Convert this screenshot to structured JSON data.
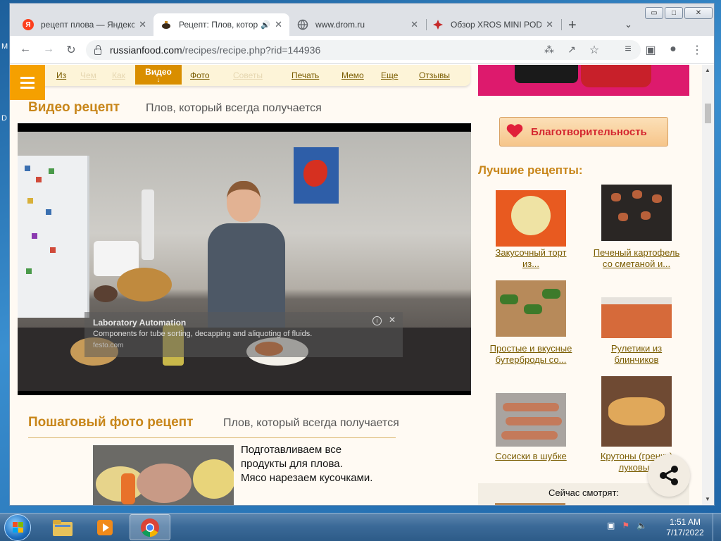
{
  "desktop": {
    "left_glyph_top": "M",
    "left_glyph_mid": "D"
  },
  "window": {
    "min_label": "▭",
    "max_label": "□",
    "close_label": "✕"
  },
  "tabs": [
    {
      "title": "рецепт плова — Яндекс",
      "favicon": "Я",
      "favicon_color": "#fc3f1d",
      "active": false
    },
    {
      "title": "Рецепт: Плов, который",
      "favicon": "",
      "favicon_color": "#ffffff",
      "active": true,
      "audio": "🔊"
    },
    {
      "title": "www.drom.ru",
      "favicon": "",
      "favicon_color": "#5f6368",
      "active": false
    },
    {
      "title": "Обзор XROS MINI POD",
      "favicon": "",
      "favicon_color": "#c62a2a",
      "active": false
    }
  ],
  "tab_close_glyph": "✕",
  "new_tab_glyph": "+",
  "tab_search_glyph": "⌄",
  "toolbar": {
    "back": "←",
    "forward": "→",
    "reload": "↻",
    "url_host": "russianfood.com",
    "url_path": "/recipes/recipe.php?rid=144936",
    "translate": "⁂",
    "share": "↗",
    "bookmark": "☆",
    "media": "≡",
    "sidepanel": "▣",
    "profile": "●",
    "menu": "⋮"
  },
  "site_nav": {
    "items": [
      "Из",
      "Чем",
      "Как",
      "Фото",
      "Советы",
      "Печать",
      "Мемо",
      "Еще",
      "Отзывы"
    ],
    "video_label": "Видео",
    "video_arrow": "↓"
  },
  "video_section": {
    "title": "Видео рецепт",
    "subtitle": "Плов, который всегда получается"
  },
  "ad": {
    "title": "Laboratory Automation",
    "description": "Components for tube sorting, decapping and aliquoting of fluids.",
    "source": "festo.com",
    "info": "i",
    "close": "✕"
  },
  "photo_section": {
    "title": "Пошаговый фото рецепт",
    "subtitle": "Плов, который всегда получается"
  },
  "step": {
    "text_1": "Подготавливаем все",
    "text_2": "продукты для плова.",
    "text_3": "Мясо нарезаем кусочками."
  },
  "sidebar": {
    "charity_label": "Благотворительность",
    "best_title": "Лучшие рецепты:",
    "recipes": [
      {
        "line1": "Закусочный торт",
        "line2": "из..."
      },
      {
        "line1": "Печеный картофель",
        "line2": "со сметаной и..."
      },
      {
        "line1": "Простые и вкусные",
        "line2": "бутерброды со..."
      },
      {
        "line1": "Рулетики из",
        "line2": "блинчиков"
      },
      {
        "line1": "Сосиски в шубке",
        "line2": ""
      },
      {
        "line1": "Крутоны (гренки)",
        "line2": "луковые"
      }
    ],
    "now_watching": "Сейчас смотрят:"
  },
  "colors": {
    "accent_orange": "#f5a000",
    "title_gold": "#c8861a",
    "link_brown": "#7a5c00",
    "charity_red": "#d4262f"
  },
  "taskbar": {
    "apps": [
      "explorer-folder",
      "media-player",
      "chrome"
    ],
    "tray_icons": [
      "network-icon",
      "flag-icon",
      "volume-icon"
    ],
    "time": "1:51 AM",
    "date": "7/17/2022"
  }
}
